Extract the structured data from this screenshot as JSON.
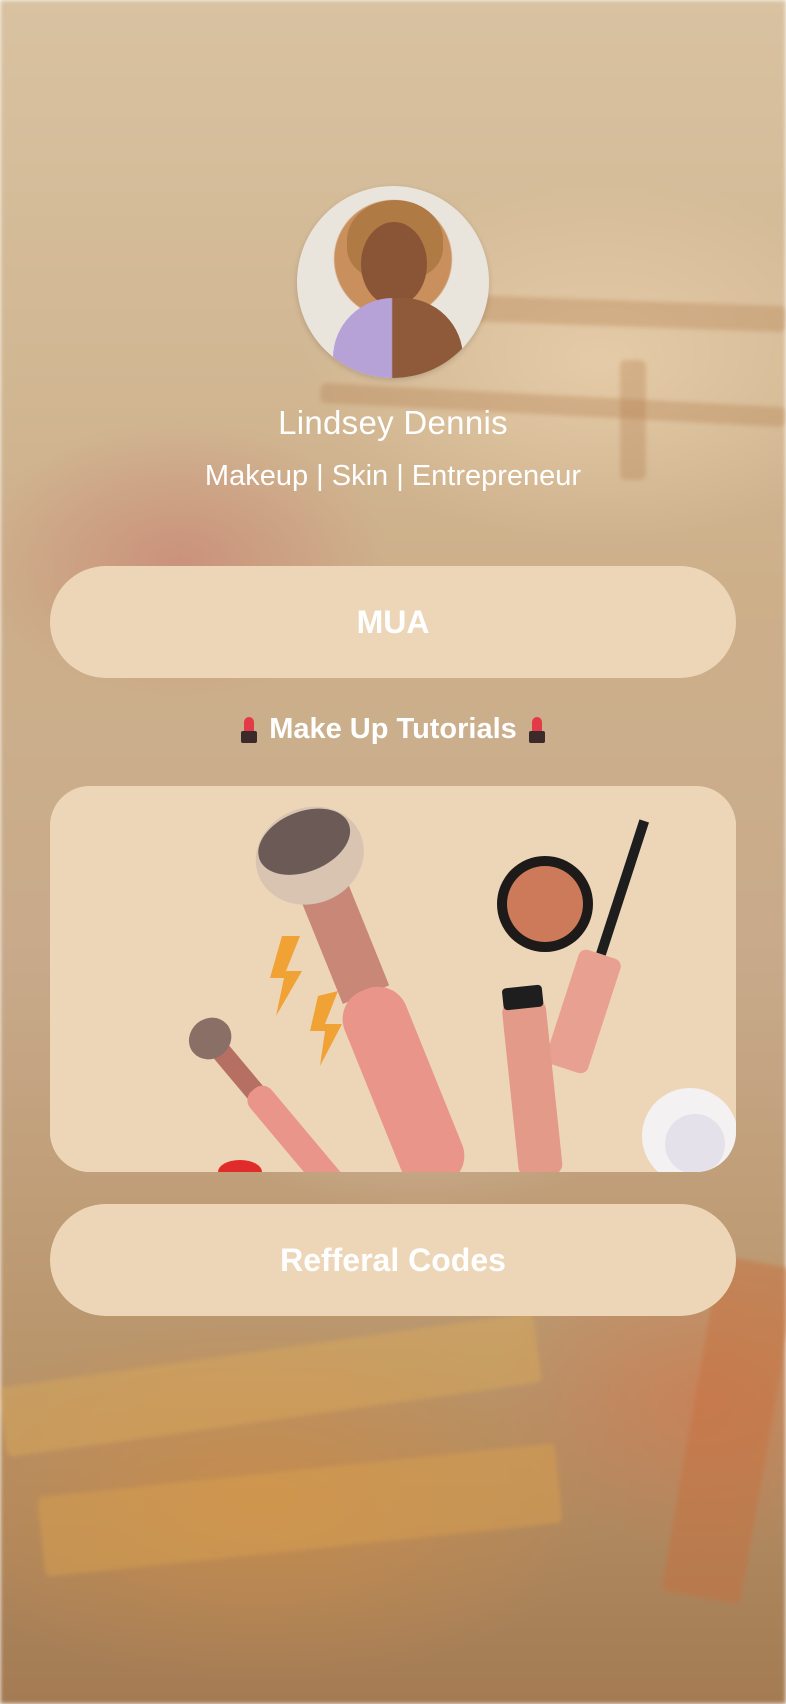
{
  "profile": {
    "name": "Lindsey Dennis",
    "bio": "Makeup | Skin | Entrepreneur",
    "avatar": "profile-photo"
  },
  "links": {
    "mua_label": "MUA",
    "tutorials_title": "Make Up Tutorials",
    "tutorials_icon": "lipstick-icon",
    "tutorials_image": "makeup-flatlay-thumbnail",
    "referral_label": "Refferal Codes"
  },
  "colors": {
    "button_bg": "#edd6b8",
    "text": "#ffffff"
  }
}
